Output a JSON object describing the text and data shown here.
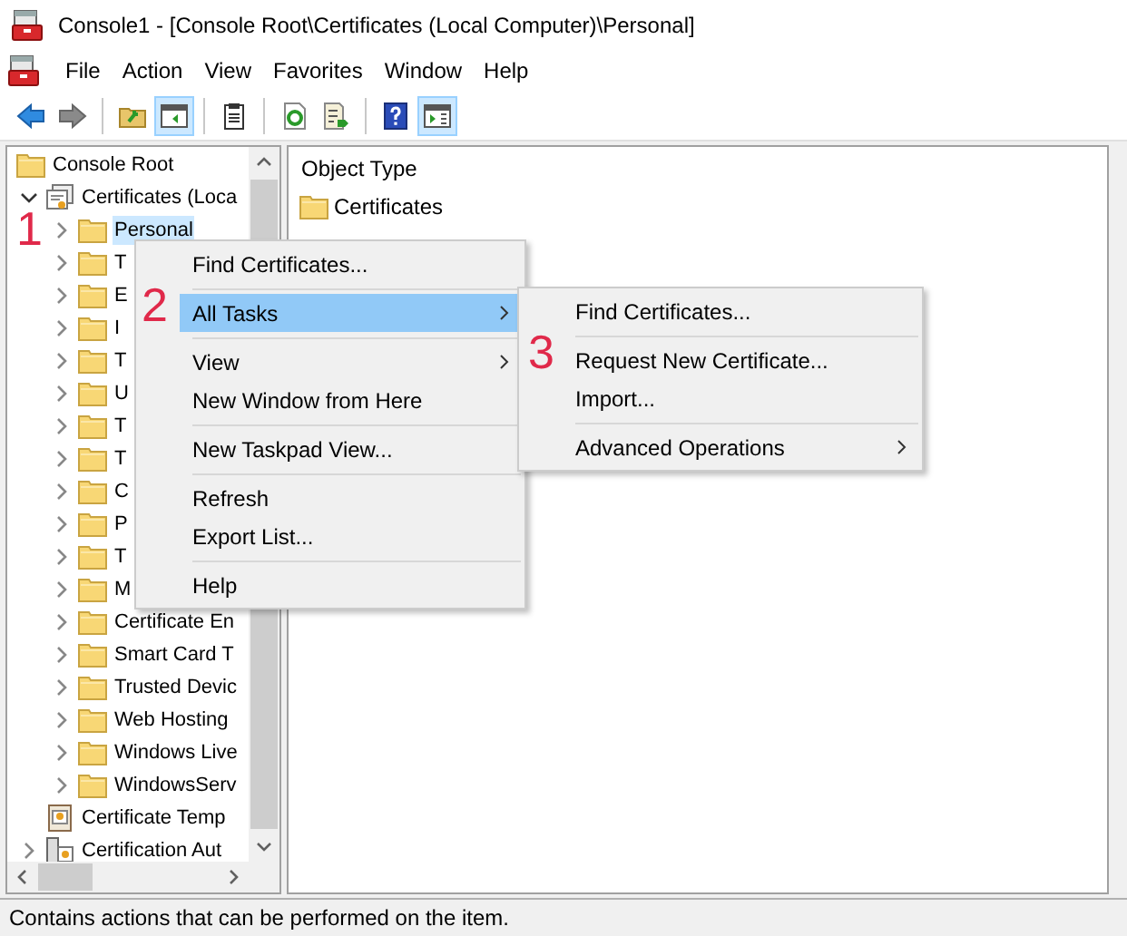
{
  "window": {
    "title": "Console1 - [Console Root\\Certificates (Local Computer)\\Personal]"
  },
  "menu_bar": [
    "File",
    "Action",
    "View",
    "Favorites",
    "Window",
    "Help"
  ],
  "toolbar": [
    {
      "kind": "back",
      "pressed": false
    },
    {
      "kind": "forward",
      "pressed": false
    },
    {
      "kind": "separator"
    },
    {
      "kind": "up",
      "pressed": false
    },
    {
      "kind": "tree",
      "pressed": true
    },
    {
      "kind": "separator"
    },
    {
      "kind": "properties",
      "pressed": false
    },
    {
      "kind": "separator"
    },
    {
      "kind": "refresh",
      "pressed": false
    },
    {
      "kind": "export",
      "pressed": false
    },
    {
      "kind": "separator"
    },
    {
      "kind": "help",
      "pressed": false
    },
    {
      "kind": "pane",
      "pressed": true
    }
  ],
  "tree": [
    {
      "label": "Console Root",
      "kind": "root",
      "selected": false,
      "children": [
        {
          "label": "Certificates (Loca",
          "kind": "store",
          "expanded": true,
          "selected": false,
          "children": [
            {
              "label": "Personal",
              "kind": "folder",
              "expanded": false,
              "selected": true
            },
            {
              "label": "T",
              "kind": "folder",
              "expanded": false,
              "selected": false
            },
            {
              "label": "E",
              "kind": "folder",
              "expanded": false,
              "selected": false
            },
            {
              "label": "I",
              "kind": "folder",
              "expanded": false,
              "selected": false
            },
            {
              "label": "T",
              "kind": "folder",
              "expanded": false,
              "selected": false
            },
            {
              "label": "U",
              "kind": "folder",
              "expanded": false,
              "selected": false
            },
            {
              "label": "T",
              "kind": "folder",
              "expanded": false,
              "selected": false
            },
            {
              "label": "T",
              "kind": "folder",
              "expanded": false,
              "selected": false
            },
            {
              "label": "C",
              "kind": "folder",
              "expanded": false,
              "selected": false
            },
            {
              "label": "P",
              "kind": "folder",
              "expanded": false,
              "selected": false
            },
            {
              "label": "T",
              "kind": "folder",
              "expanded": false,
              "selected": false
            },
            {
              "label": "M",
              "kind": "folder",
              "expanded": false,
              "selected": false
            },
            {
              "label": "Certificate En",
              "kind": "folder",
              "expanded": false,
              "selected": false
            },
            {
              "label": "Smart Card T",
              "kind": "folder",
              "expanded": false,
              "selected": false
            },
            {
              "label": "Trusted Devic",
              "kind": "folder",
              "expanded": false,
              "selected": false
            },
            {
              "label": "Web Hosting",
              "kind": "folder",
              "expanded": false,
              "selected": false
            },
            {
              "label": "Windows Live",
              "kind": "folder",
              "expanded": false,
              "selected": false
            },
            {
              "label": "WindowsServ",
              "kind": "folder",
              "expanded": false,
              "selected": false
            }
          ]
        },
        {
          "label": "Certificate Temp",
          "kind": "template",
          "selected": false
        },
        {
          "label": "Certification Aut",
          "kind": "ca",
          "expanded": false,
          "selected": false
        }
      ]
    }
  ],
  "list": {
    "columns": [
      "Object Type"
    ],
    "rows": [
      {
        "label": "Certificates",
        "kind": "folder"
      }
    ]
  },
  "context_menu": [
    {
      "kind": "item",
      "label": "Find Certificates...",
      "submenu": false,
      "selected": false
    },
    {
      "kind": "separator"
    },
    {
      "kind": "item",
      "label": "All Tasks",
      "submenu": true,
      "selected": true
    },
    {
      "kind": "separator"
    },
    {
      "kind": "item",
      "label": "View",
      "submenu": true,
      "selected": false
    },
    {
      "kind": "item",
      "label": "New Window from Here",
      "submenu": false,
      "selected": false
    },
    {
      "kind": "separator"
    },
    {
      "kind": "item",
      "label": "New Taskpad View...",
      "submenu": false,
      "selected": false
    },
    {
      "kind": "separator"
    },
    {
      "kind": "item",
      "label": "Refresh",
      "submenu": false,
      "selected": false
    },
    {
      "kind": "item",
      "label": "Export List...",
      "submenu": false,
      "selected": false
    },
    {
      "kind": "separator"
    },
    {
      "kind": "item",
      "label": "Help",
      "submenu": false,
      "selected": false
    }
  ],
  "submenu": [
    {
      "kind": "item",
      "label": "Find Certificates...",
      "submenu": false,
      "selected": false
    },
    {
      "kind": "separator"
    },
    {
      "kind": "item",
      "label": "Request New Certificate...",
      "submenu": false,
      "selected": false
    },
    {
      "kind": "item",
      "label": "Import...",
      "submenu": false,
      "selected": false
    },
    {
      "kind": "separator"
    },
    {
      "kind": "item",
      "label": "Advanced Operations",
      "submenu": true,
      "selected": false
    }
  ],
  "annotations": [
    "1",
    "2",
    "3"
  ],
  "status_bar": "Contains actions that can be performed on the item."
}
